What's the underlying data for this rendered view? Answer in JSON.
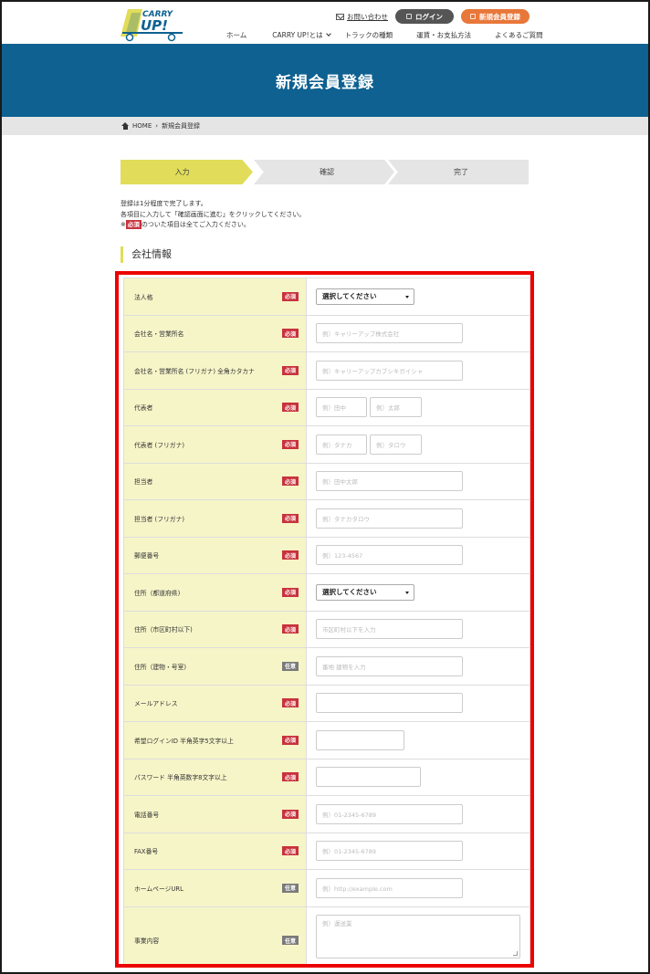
{
  "header": {
    "logo_text_top": "CARRY",
    "logo_text_main": "UP!",
    "contact_link": "お問い合わせ",
    "login_button": "ログイン",
    "register_button": "新規会員登録",
    "nav": [
      "ホーム",
      "CARRY UP!とは",
      "トラックの種類",
      "運賃・お支払方法",
      "よくあるご質問"
    ],
    "brand_colors": {
      "logo_yellow": "#e1dd5a",
      "logo_blue": "#0e6190",
      "register": "#e8773a"
    }
  },
  "banner": {
    "title": "新規会員登録"
  },
  "breadcrumb": {
    "home": "HOME",
    "separator": "›",
    "current": "新規会員登録"
  },
  "steps": [
    "入力",
    "確認",
    "完了"
  ],
  "intro": {
    "line1": "登録は1分程度で完了します。",
    "line2": "各項目に入力して「確認画面に進む」をクリックしてください。",
    "line3_prefix": "※",
    "line3_badge": "必須",
    "line3_suffix": "のついた項目は全てご入力ください。"
  },
  "section_title": "会社情報",
  "badges": {
    "required": "必須",
    "optional": "任意"
  },
  "form": {
    "legal_entity": {
      "label": "法人格",
      "select": "選択してください"
    },
    "company_name": {
      "label": "会社名・営業所名",
      "placeholder": "例）キャリーアップ株式会社"
    },
    "company_kana": {
      "label": "会社名・営業所名 (フリガナ) 全角カタカナ",
      "placeholder": "例）キャリーアップカブシキガイシャ"
    },
    "representative": {
      "label": "代表者",
      "placeholder_last": "例）田中",
      "placeholder_first": "例）太郎"
    },
    "representative_kana": {
      "label": "代表者 (フリガナ)",
      "placeholder_last": "例）タナカ",
      "placeholder_first": "例）タロウ"
    },
    "contact_person": {
      "label": "担当者",
      "placeholder": "例）田中太郎"
    },
    "contact_person_kana": {
      "label": "担当者 (フリガナ)",
      "placeholder": "例）タナカタロウ"
    },
    "postal_code": {
      "label": "郵便番号",
      "placeholder": "例）123-4567"
    },
    "prefecture": {
      "label": "住所（都道府県)",
      "select": "選択してください"
    },
    "address_city": {
      "label": "住所（市区町村以下)",
      "placeholder": "市区町村以下を入力"
    },
    "address_building": {
      "label": "住所（建物・号室)",
      "placeholder": "番地 建物を入力"
    },
    "email": {
      "label": "メールアドレス",
      "placeholder": ""
    },
    "login_id": {
      "label": "希望ログインID 半角英字5文字以上",
      "placeholder": ""
    },
    "password": {
      "label": "パスワード 半角英数字8文字以上",
      "placeholder": ""
    },
    "phone": {
      "label": "電話番号",
      "placeholder": "例）01-2345-6789"
    },
    "fax": {
      "label": "FAX番号",
      "placeholder": "例）01-2345-6789"
    },
    "homepage": {
      "label": "ホームページURL",
      "placeholder": "例）http://example.com"
    },
    "business": {
      "label": "事業内容",
      "placeholder": "例）運送業"
    }
  }
}
